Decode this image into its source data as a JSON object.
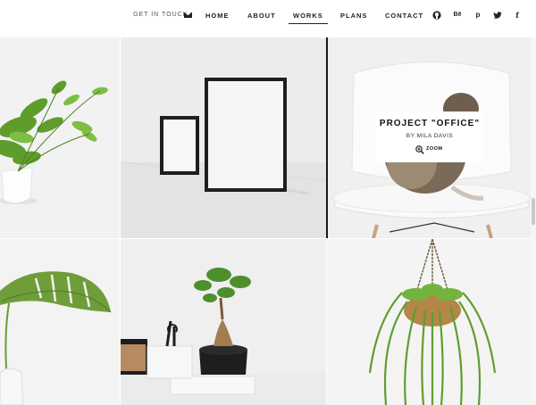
{
  "header": {
    "get_in_touch": "GET IN TOUCH",
    "nav": {
      "home": "HOME",
      "about": "ABOUT",
      "works": "WORKS",
      "plans": "PLANS",
      "contact": "CONTACT"
    },
    "active_nav": "WORKS",
    "social": {
      "behance": "Bē",
      "pinterest": "p",
      "facebook": "f"
    }
  },
  "gallery": {
    "overlay": {
      "title": "PROJECT \"OFFICE\"",
      "author": "BY MILA DAVIS",
      "zoom_label": "ZOOM"
    }
  },
  "colors": {
    "text": "#222222",
    "background": "#ffffff",
    "divider": "#1a1a1a"
  },
  "icons": [
    "mail-icon",
    "github-icon",
    "behance-icon",
    "pinterest-icon",
    "twitter-icon",
    "facebook-icon",
    "zoom-icon"
  ]
}
